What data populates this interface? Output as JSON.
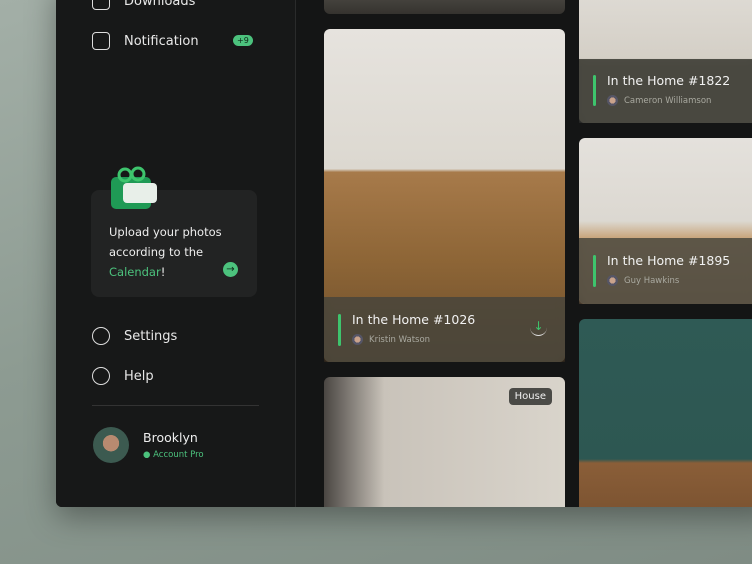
{
  "sidebar": {
    "items": [
      {
        "label": "Downloads",
        "icon": "inbox-icon"
      },
      {
        "label": "Notification",
        "icon": "notification-icon",
        "badge": "+9"
      },
      {
        "label": "Settings",
        "icon": "settings-icon"
      },
      {
        "label": "Help",
        "icon": "help-icon"
      }
    ],
    "promo": {
      "line1": "Upload your photos",
      "line2": "according to the",
      "link": "Calendar",
      "suffix": "!"
    },
    "user": {
      "name": "Brooklyn",
      "plan": "Account Pro"
    }
  },
  "cards": [
    {
      "title": "In the Home #1026",
      "author": "Kristin Watson"
    },
    {
      "title": "In the Home #1822",
      "author": "Cameron Williamson"
    },
    {
      "title": "In the Home #1895",
      "author": "Guy Hawkins"
    },
    {
      "tag": "House"
    }
  ],
  "colors": {
    "accent": "#4cc27d"
  }
}
